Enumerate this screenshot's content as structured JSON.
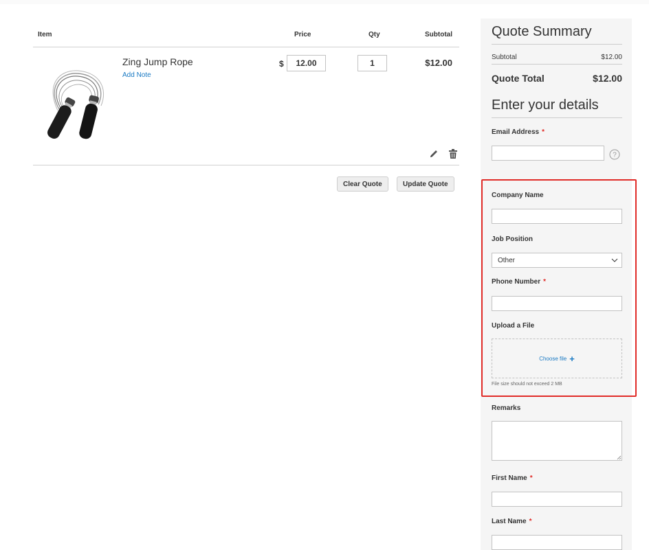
{
  "table": {
    "headers": {
      "item": "Item",
      "price": "Price",
      "qty": "Qty",
      "subtotal": "Subtotal"
    },
    "row": {
      "product_name": "Zing Jump Rope",
      "add_note": "Add Note",
      "currency": "$",
      "price": "12.00",
      "qty": "1",
      "subtotal": "$12.00"
    },
    "actions": {
      "clear": "Clear Quote",
      "update": "Update Quote"
    }
  },
  "summary": {
    "title": "Quote Summary",
    "subtotal_label": "Subtotal",
    "subtotal_value": "$12.00",
    "total_label": "Quote Total",
    "total_value": "$12.00"
  },
  "details": {
    "title": "Enter your details",
    "email_label": "Email Address",
    "company_label": "Company Name",
    "job_label": "Job Position",
    "job_value": "Other",
    "phone_label": "Phone Number",
    "upload_label": "Upload a File",
    "choose_file": "Choose file",
    "file_note": "File size should not exceed 2 MB",
    "remarks_label": "Remarks",
    "first_name_label": "First Name",
    "last_name_label": "Last Name",
    "required_mark": "*"
  },
  "colors": {
    "link": "#1979c3",
    "required": "#e02b27",
    "highlight": "#e02b27",
    "sidebar_bg": "#f5f5f5"
  }
}
